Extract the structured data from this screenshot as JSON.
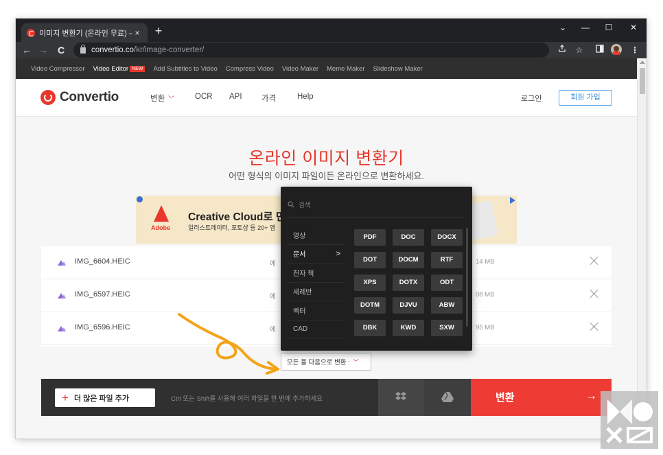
{
  "browser": {
    "tab_title": "이미지 변환기 (온라인 무료) —",
    "tab_close": "×",
    "new_tab": "+",
    "window_controls": [
      "⌄",
      "—",
      "☐",
      "✕"
    ],
    "nav": {
      "back": "←",
      "forward": "→",
      "reload": "C"
    },
    "url_host": "convertio.co",
    "url_path": "/kr/image-converter/",
    "addr_icons": [
      "share-icon",
      "star-icon",
      "sidebar-icon",
      "profile-avatar",
      "menu-icon"
    ]
  },
  "promobar": {
    "links": [
      "Video Compressor",
      "Video Editor",
      "Add Subtitles to Video",
      "Compress Video",
      "Video Maker",
      "Meme Maker",
      "Slideshow Maker"
    ],
    "new_badge": "NEW"
  },
  "header": {
    "logo_text": "Convertio",
    "nav": {
      "convert": "변환",
      "ocr": "OCR",
      "api": "API",
      "pricing": "가격",
      "help": "Help"
    },
    "login": "로그인",
    "signup": "회원 가입"
  },
  "hero": {
    "title": "온라인 이미지 변환기",
    "subtitle": "어떤 형식의 이미지 파일이든 온라인으로 변환하세요."
  },
  "ad": {
    "brand": "Adobe",
    "headline": "Creative Cloud로 만드",
    "body": "일러스트레이터, 포토샵 등 20+ 앱"
  },
  "files": [
    {
      "name": "IMG_6604.HEIC",
      "to": "에",
      "size": "14 MB"
    },
    {
      "name": "IMG_6597.HEIC",
      "to": "에",
      "size": "08 MB"
    },
    {
      "name": "IMG_6596.HEIC",
      "to": "에",
      "size": "95 MB"
    }
  ],
  "convert_all": {
    "label": "모든 을 다음으로 변환 :"
  },
  "bottombar": {
    "add_more": "더 많은 파일 추가",
    "hint": "Ctrl 또는 Shift를 사용해 여러 파일을 한 번에 추가하세요",
    "convert": "변환",
    "arrow": "→"
  },
  "dropdown": {
    "search_placeholder": "검색",
    "categories": [
      "영상",
      "문서",
      "전자 책",
      "세례반",
      "벡터",
      "CAD"
    ],
    "active_category": "문서",
    "caret": ">",
    "formats": [
      "PDF",
      "DOC",
      "DOCX",
      "DOT",
      "DOCM",
      "RTF",
      "XPS",
      "DOTX",
      "ODT",
      "DOTM",
      "DJVU",
      "ABW",
      "DBK",
      "KWD",
      "SXW"
    ]
  },
  "colors": {
    "accent": "#e8372c",
    "convert_button": "#ee3b34",
    "annotation": "#f4a318"
  }
}
